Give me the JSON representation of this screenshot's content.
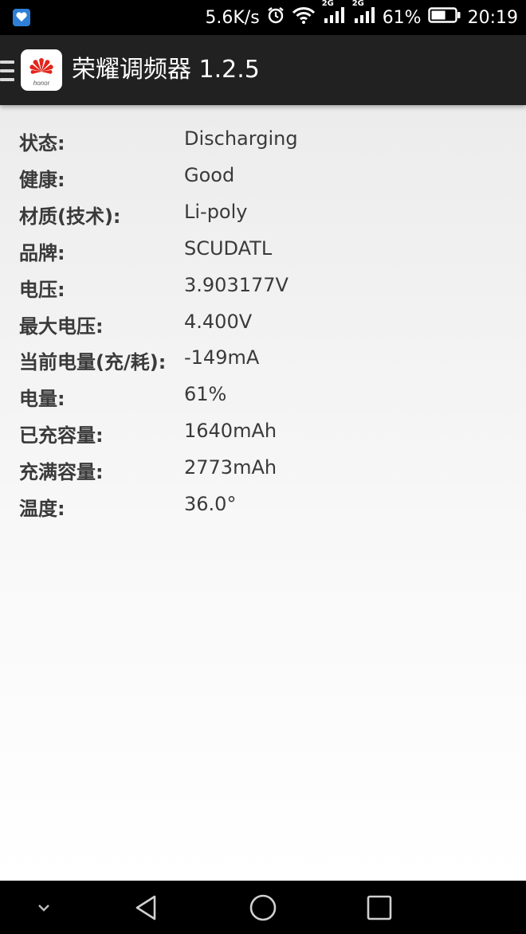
{
  "status_bar": {
    "net_speed": "5.6K/s",
    "signal1_label": "2G",
    "signal2_label": "2G",
    "battery_percent": "61%",
    "battery_level": 0.61,
    "time": "20:19"
  },
  "app_bar": {
    "title": "荣耀调频器 1.2.5",
    "icon_brand": "honor",
    "icon_brand_color": "#e1251b"
  },
  "battery_info": {
    "rows": [
      {
        "label": "状态:",
        "value": "Discharging"
      },
      {
        "label": "健康:",
        "value": "Good"
      },
      {
        "label": "材质(技术):",
        "value": "Li-poly"
      },
      {
        "label": "品牌:",
        "value": "SCUDATL"
      },
      {
        "label": "电压:",
        "value": "3.903177V"
      },
      {
        "label": "最大电压:",
        "value": "4.400V"
      },
      {
        "label": "当前电量(充/耗):",
        "value": "-149mA"
      },
      {
        "label": "电量:",
        "value": "61%"
      },
      {
        "label": "已充容量:",
        "value": "1640mAh"
      },
      {
        "label": "充满容量:",
        "value": "2773mAh"
      },
      {
        "label": "温度:",
        "value": "36.0°"
      }
    ]
  },
  "nav_bar": {
    "icons": [
      "chevron-down-icon",
      "back-icon",
      "home-icon",
      "recents-icon"
    ]
  }
}
